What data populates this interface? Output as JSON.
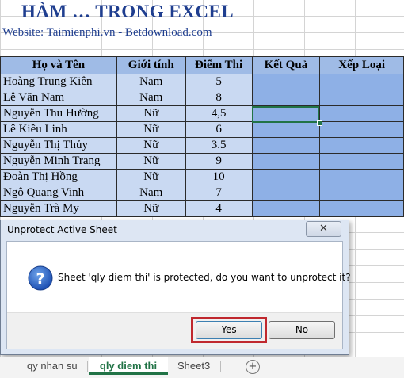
{
  "sheet": {
    "title": "HÀM … TRONG EXCEL",
    "website": "Website: Taimienphi.vn - Betdownload.com",
    "headers": [
      "Họ và Tên",
      "Giới tính",
      "Điểm Thi",
      "Kết Quả",
      "Xếp Loại"
    ],
    "rows": [
      [
        "Hoàng Trung Kiên",
        "Nam",
        "5"
      ],
      [
        "Lê Văn Nam",
        "Nam",
        "8"
      ],
      [
        "Nguyễn Thu Hường",
        "Nữ",
        "4,5"
      ],
      [
        "Lê Kiều Linh",
        "Nữ",
        "6"
      ],
      [
        "Nguyễn Thị Thủy",
        "Nữ",
        "3.5"
      ],
      [
        "Nguyễn Minh Trang",
        "Nữ",
        "9"
      ],
      [
        "Đoàn Thị Hồng",
        "Nữ",
        "10"
      ],
      [
        "Ngô Quang Vinh",
        "Nam",
        "7"
      ],
      [
        "Nguyễn Trà My",
        "Nữ",
        "4"
      ]
    ]
  },
  "dialog": {
    "title": "Unprotect Active Sheet",
    "close_label": "✕",
    "icon": "question-icon",
    "message": "Sheet 'qly diem thi' is protected, do you want to unprotect it?",
    "yes_label": "Yes",
    "no_label": "No"
  },
  "tabs": {
    "items": [
      "qy nhan su",
      "qly diem thi",
      "Sheet3"
    ],
    "active": "qly diem thi",
    "add_label": "+"
  },
  "colors": {
    "header_fill": "#9fbbe6",
    "cell_fill": "#c9d9f2",
    "result_fill": "#8eb0e6",
    "title_color": "#1f3e8f",
    "highlight": "#c0282e",
    "excel_green": "#217346"
  }
}
